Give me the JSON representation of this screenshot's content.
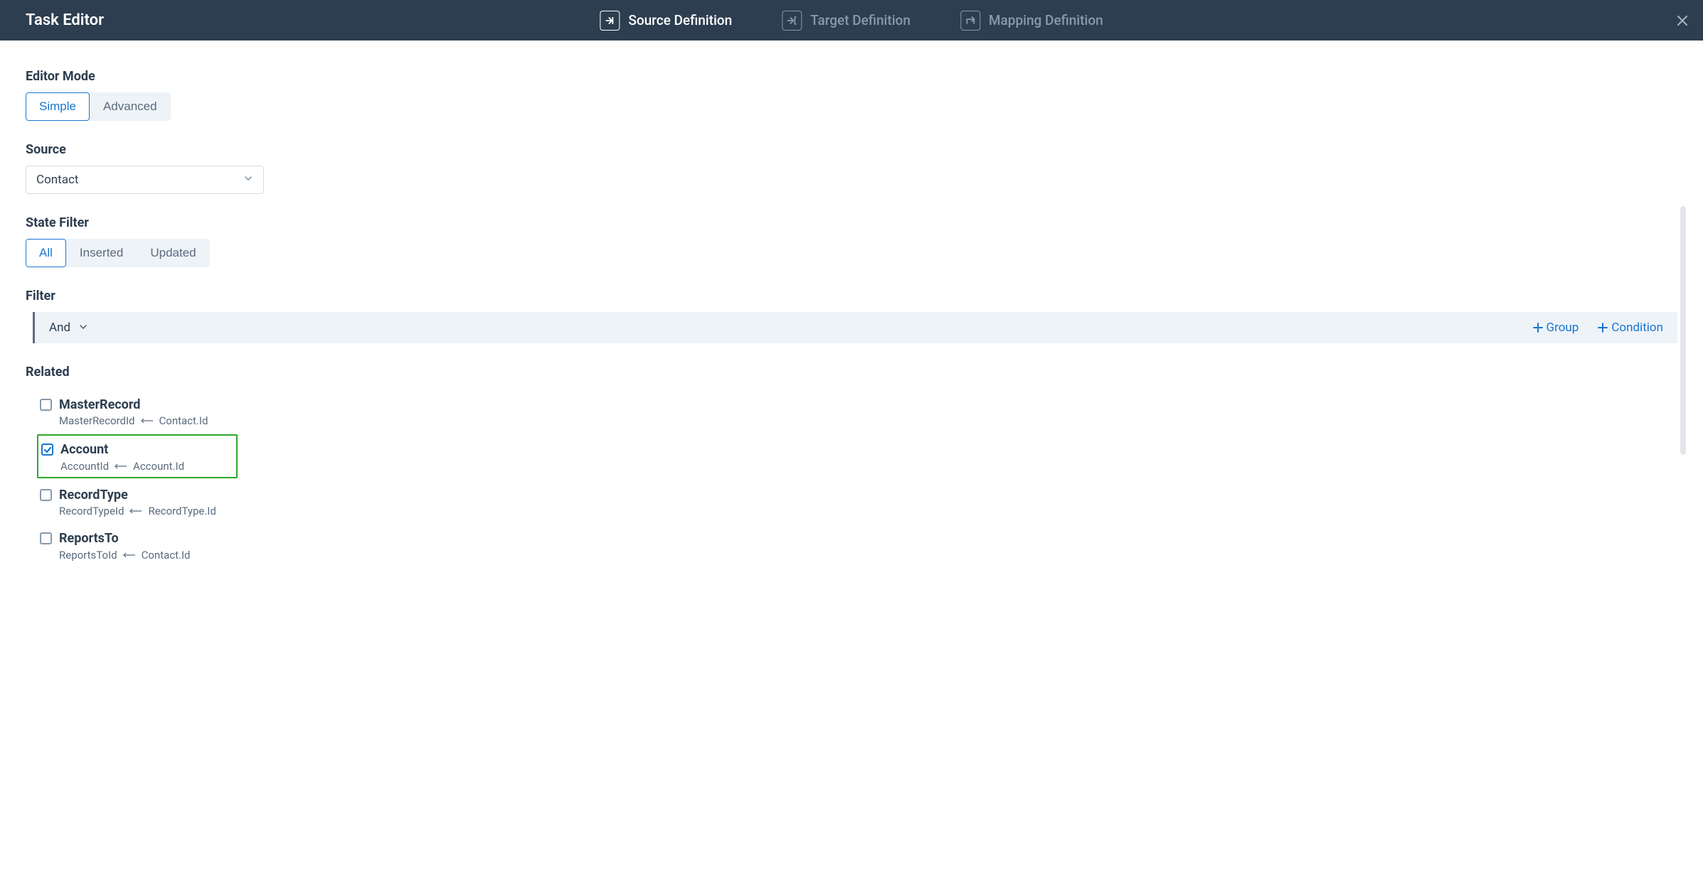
{
  "header": {
    "title": "Task Editor",
    "tabs": [
      {
        "label": "Source Definition",
        "active": true
      },
      {
        "label": "Target Definition",
        "active": false
      },
      {
        "label": "Mapping Definition",
        "active": false
      }
    ]
  },
  "editorMode": {
    "label": "Editor Mode",
    "options": [
      "Simple",
      "Advanced"
    ],
    "active": "Simple"
  },
  "source": {
    "label": "Source",
    "value": "Contact"
  },
  "stateFilter": {
    "label": "State Filter",
    "options": [
      "All",
      "Inserted",
      "Updated"
    ],
    "active": "All"
  },
  "filter": {
    "label": "Filter",
    "operator": "And",
    "actions": {
      "group": "Group",
      "condition": "Condition"
    }
  },
  "related": {
    "label": "Related",
    "items": [
      {
        "title": "MasterRecord",
        "left": "MasterRecordId",
        "right": "Contact.Id",
        "checked": false,
        "highlighted": false
      },
      {
        "title": "Account",
        "left": "AccountId",
        "right": "Account.Id",
        "checked": true,
        "highlighted": true
      },
      {
        "title": "RecordType",
        "left": "RecordTypeId",
        "right": "RecordType.Id",
        "checked": false,
        "highlighted": false
      },
      {
        "title": "ReportsTo",
        "left": "ReportsToId",
        "right": "Contact.Id",
        "checked": false,
        "highlighted": false
      }
    ]
  }
}
